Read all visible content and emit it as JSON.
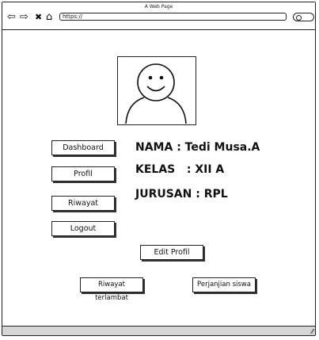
{
  "window": {
    "title": "A Web Page",
    "url": "https://"
  },
  "nav": {
    "back": "⇦",
    "forward": "⇨",
    "stop": "✖",
    "home": "⌂"
  },
  "sidebar": {
    "items": [
      {
        "label": "Dashboard"
      },
      {
        "label": "Profil"
      },
      {
        "label": "Riwayat"
      },
      {
        "label": "Logout"
      }
    ]
  },
  "profile": {
    "nama": "NAMA : Tedi Musa.A",
    "kelas": "KELAS   : XII A",
    "jurusan": "JURUSAN : RPL"
  },
  "actions": {
    "edit_profil": "Edit Profil",
    "riwayat_terlambat": "Riwayat terlambat",
    "perjanjian_siswa": "Perjanjian siswa"
  },
  "statusbar": {
    "resize_glyph": "⁄⁄"
  }
}
